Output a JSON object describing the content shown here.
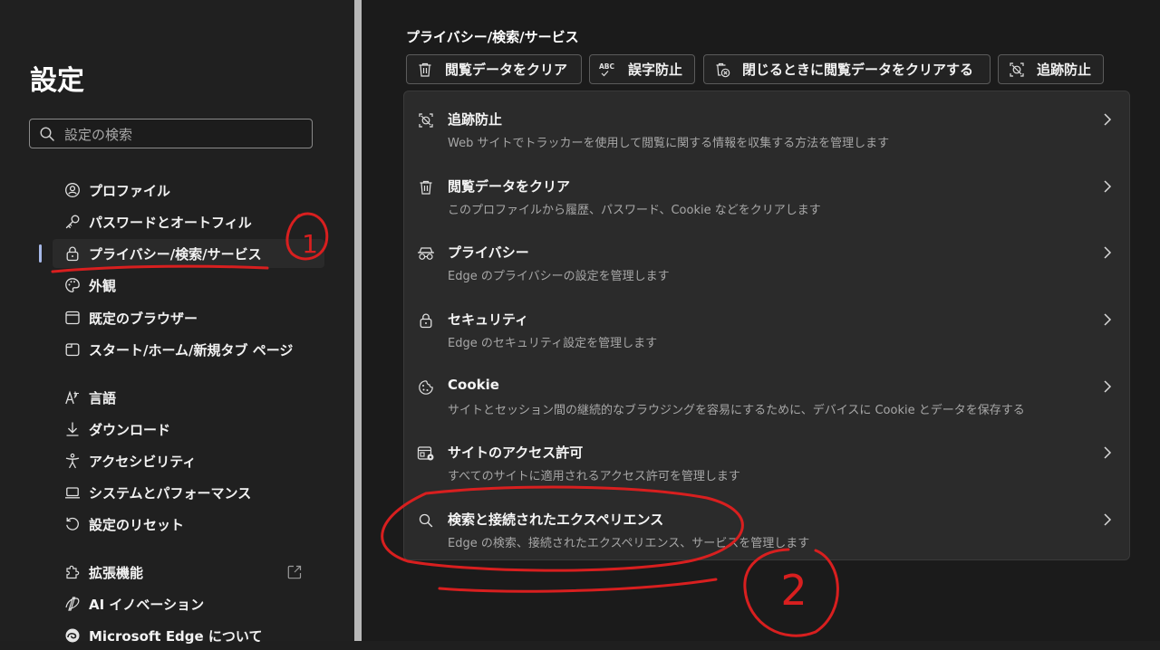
{
  "sidebar": {
    "title": "設定",
    "search_placeholder": "設定の検索",
    "items": [
      {
        "label": "プロファイル",
        "icon": "profile-icon"
      },
      {
        "label": "パスワードとオートフィル",
        "icon": "key-icon"
      },
      {
        "label": "プライバシー/検索/サービス",
        "icon": "lock-icon",
        "active": true
      },
      {
        "label": "外観",
        "icon": "palette-icon"
      },
      {
        "label": "既定のブラウザー",
        "icon": "browser-icon"
      },
      {
        "label": "スタート/ホーム/新規タブ ページ",
        "icon": "home-icon"
      },
      {
        "label": "言語",
        "icon": "language-icon"
      },
      {
        "label": "ダウンロード",
        "icon": "download-icon"
      },
      {
        "label": "アクセシビリティ",
        "icon": "accessibility-icon"
      },
      {
        "label": "システムとパフォーマンス",
        "icon": "laptop-icon"
      },
      {
        "label": "設定のリセット",
        "icon": "reset-icon"
      },
      {
        "label": "拡張機能",
        "icon": "puzzle-icon"
      },
      {
        "label": "AI イノベーション",
        "icon": "ai-icon"
      },
      {
        "label": "Microsoft Edge について",
        "icon": "edge-icon"
      }
    ]
  },
  "main": {
    "section_title": "プライバシー/検索/サービス",
    "quick_buttons": [
      {
        "label": "閲覧データをクリア",
        "icon": "trash-icon"
      },
      {
        "label": "誤字防止",
        "icon": "spellcheck-icon"
      },
      {
        "label": "閉じるときに閲覧データをクリアする",
        "icon": "trash-clock-icon"
      },
      {
        "label": "追跡防止",
        "icon": "tracking-icon"
      }
    ],
    "rows": [
      {
        "title": "追跡防止",
        "desc": "Web サイトでトラッカーを使用して閲覧に関する情報を収集する方法を管理します",
        "icon": "tracking-icon"
      },
      {
        "title": "閲覧データをクリア",
        "desc": "このプロファイルから履歴、パスワード、Cookie などをクリアします",
        "icon": "trash-icon"
      },
      {
        "title": "プライバシー",
        "desc": "Edge のプライバシーの設定を管理します",
        "icon": "incognito-icon"
      },
      {
        "title": "セキュリティ",
        "desc": "Edge のセキュリティ設定を管理します",
        "icon": "lock-icon"
      },
      {
        "title": "Cookie",
        "desc": "サイトとセッション間の継続的なブラウジングを容易にするために、デバイスに Cookie とデータを保存する",
        "icon": "cookie-icon"
      },
      {
        "title": "サイトのアクセス許可",
        "desc": "すべてのサイトに適用されるアクセス許可を管理します",
        "icon": "site-permissions-icon"
      },
      {
        "title": "検索と接続されたエクスペリエンス",
        "desc": "Edge の検索、接続されたエクスペリエンス、サービスを管理します",
        "icon": "search-icon"
      }
    ]
  },
  "annotations": {
    "mark1": "1",
    "mark2": "2",
    "color": "#d81f1f"
  }
}
